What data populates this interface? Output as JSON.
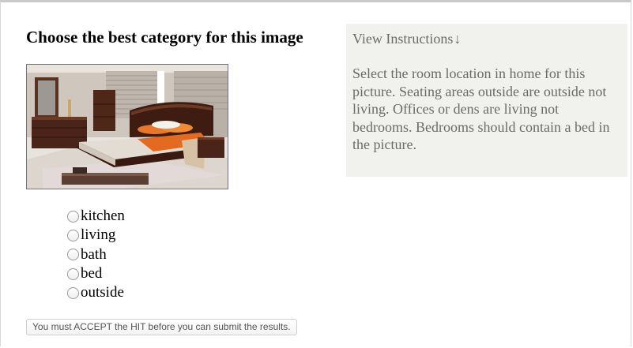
{
  "page": {
    "title": "Choose the best category for this image"
  },
  "image": {
    "subject": "bedroom"
  },
  "instructions": {
    "toggle_label": "View Instructions",
    "toggle_icon": "↓",
    "text": "Select the room location in home for this picture. Seating areas outside are outside not living. Offices or dens are living not bedrooms. Bedrooms should contain a bed in the picture."
  },
  "options": [
    {
      "label": "kitchen",
      "selected": false
    },
    {
      "label": "living",
      "selected": false
    },
    {
      "label": "bath",
      "selected": false
    },
    {
      "label": "bed",
      "selected": false
    },
    {
      "label": "outside",
      "selected": false
    }
  ],
  "footer": {
    "submit_note": "You must ACCEPT the HIT before you can submit the results."
  }
}
